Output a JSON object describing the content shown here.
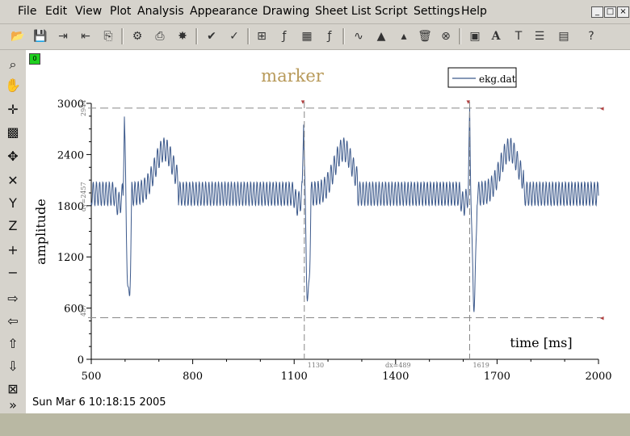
{
  "menu": [
    "File",
    "Edit",
    "View",
    "Plot",
    "Analysis",
    "Appearance",
    "Drawing",
    "Sheet List",
    "Script",
    "Settings",
    "Help"
  ],
  "window_controls": [
    "minimize-icon",
    "restore-icon",
    "close-icon"
  ],
  "toolbar_icons": [
    "open-icon",
    "save-icon",
    "export-icon",
    "import-icon",
    "copy-icon",
    "print-preview-icon",
    "print-icon",
    "clear-icon",
    "plot-wizard-icon",
    "add-curve-icon",
    "table-icon",
    "function-icon",
    "matrix-icon",
    "fit-icon",
    "graph-icon",
    "vector-icon",
    "pyramid-icon",
    "erase-icon",
    "stop-icon",
    "image-icon",
    "text-bold-icon",
    "text-icon",
    "notes-icon",
    "analysis-icon",
    "help-icon"
  ],
  "left_tools": [
    "zoom-icon",
    "pan-icon",
    "crosshair-icon",
    "screen-reader-icon",
    "move-points-icon",
    "remove-points-icon",
    "y-axis-icon",
    "z-axis-icon",
    "add-marker-icon",
    "minus-icon",
    "right-arrow-icon",
    "left-arrow-icon",
    "up-arrow-icon",
    "down-arrow-icon",
    "add-layer-icon",
    "more-icon"
  ],
  "layer_label": "0",
  "status": "Sun Mar 6 10:18:15 2005",
  "colors": {
    "curve": "#3d5a8c",
    "title": "#b89a5a",
    "marker_line": "#888888"
  },
  "chart_data": {
    "type": "line",
    "title": "marker",
    "xlabel": "time [ms]",
    "ylabel": "amplitude",
    "xlim": [
      500,
      2000
    ],
    "ylim": [
      0,
      3000
    ],
    "xticks": [
      500,
      800,
      1100,
      1400,
      1700,
      2000
    ],
    "yticks": [
      0,
      600,
      1200,
      1800,
      2400,
      3000
    ],
    "legend": "ekg.dat",
    "legend_position": "top-right",
    "series": [
      {
        "name": "ekg.dat",
        "beats_at_ms": [
          598,
          1128,
          1619
        ]
      }
    ],
    "markers": {
      "vertical_lines_ms": [
        1130,
        1619
      ],
      "horizontal_lines": [
        2944,
        487
      ],
      "labels": {
        "x1": "1130",
        "x2": "1619",
        "dx": "dx=489",
        "y_top": "2944",
        "y_bottom": "487",
        "dy": "dy=2457"
      }
    }
  }
}
